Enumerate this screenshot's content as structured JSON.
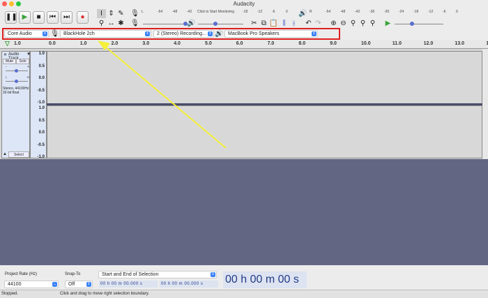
{
  "window": {
    "title": "Audacity"
  },
  "transport": {
    "pause": "pause-icon",
    "play": "play-icon",
    "stop": "stop-icon",
    "skip_start": "skip-start-icon",
    "skip_end": "skip-end-icon",
    "record": "record-icon",
    "play_color": "#3aa33a",
    "record_color": "#e02a2a"
  },
  "meters": {
    "record_ticks": [
      "-54",
      "-48",
      "-42",
      "-18",
      "-12",
      "-6",
      "0"
    ],
    "monitor_label": "Click to Start Monitoring",
    "playback_ticks": [
      "-54",
      "-48",
      "-42",
      "-36",
      "-30",
      "-24",
      "-18",
      "-12",
      "-6",
      "0"
    ],
    "channel_labels": [
      "L",
      "R"
    ]
  },
  "device": {
    "host": "Core Audio",
    "input": "BlackHole 2ch",
    "channels": "2 (Stereo) Recording...",
    "output": "MacBook Pro Speakers",
    "highlight_color": "#e02020"
  },
  "ruler": {
    "ticks": [
      "1.0",
      "0.0",
      "1.0",
      "2.0",
      "3.0",
      "4.0",
      "5.0",
      "6.0",
      "7.0",
      "8.0",
      "9.0",
      "10.0",
      "11.0",
      "12.0",
      "13.0",
      "14.0"
    ]
  },
  "track": {
    "name": "Audio Track",
    "mute": "Mute",
    "solo": "Solo",
    "gain_minus": "-",
    "gain_plus": "+",
    "pan_left": "L",
    "pan_right": "R",
    "info1": "Stereo, 44100Hz",
    "info2": "32-bit float",
    "select": "Select",
    "scale": [
      "1.0",
      "0.5",
      "0.0",
      "-0.5",
      "-1.0"
    ]
  },
  "bottom": {
    "rate_label": "Project Rate (Hz)",
    "rate_value": "44100",
    "snap_label": "Snap-To",
    "snap_value": "Off",
    "selection_mode": "Start and End of Selection",
    "sel_start": "00 h 00 m 00.000 s",
    "sel_end": "00 h 00 m 00.000 s",
    "time": "00 h 00 m 00 s"
  },
  "status": {
    "state": "Stopped.",
    "hint": "Click and drag to move right selection boundary."
  },
  "annotation": {
    "arrow_color": "#f5f03a"
  }
}
